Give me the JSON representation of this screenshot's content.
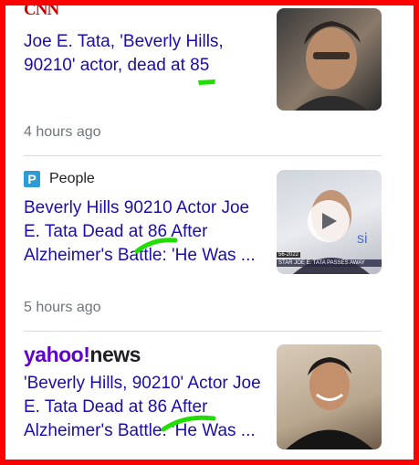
{
  "articles": [
    {
      "source": "CNN",
      "headline": "Joe E. Tata, 'Beverly Hills, 90210' actor, dead at 85",
      "time": "4 hours ago",
      "thumbnail_icon": "person-photo-icon"
    },
    {
      "source": "People",
      "source_badge": "P",
      "headline": "Beverly Hills 90210 Actor Joe E. Tata Dead at 86 After Alzheimer's Battle: 'He Was ...",
      "time": "5 hours ago",
      "thumbnail_icon": "video-thumbnail-icon",
      "video_caption_date": "56-2022",
      "video_caption": "STAR JOE E. TATA PASSES AWAY"
    },
    {
      "source_part1": "yahoo",
      "source_bang": "!",
      "source_part2": "news",
      "headline": "'Beverly Hills, 90210' Actor Joe E. Tata Dead at 86 After Alzheimer's Battle: 'He Was ...",
      "thumbnail_icon": "person-photo-icon"
    }
  ],
  "colors": {
    "headline": "#1a0dab",
    "timestamp": "#70757a",
    "frame": "#ff0000",
    "highlight": "#22dd00"
  }
}
